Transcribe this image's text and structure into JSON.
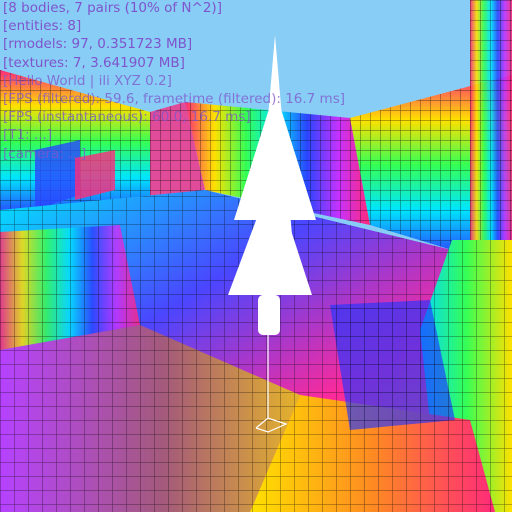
{
  "hud": {
    "lines": [
      "[8 bodies, 7 pairs (10% of N^2)]",
      "[entities: 8]",
      "[rmodels: 97, 0.351723 MB]",
      "[textures: 7, 3.641907 MB]",
      "[Hello World | ili XYZ 0.2]",
      "[FPS (filtered): 59.6, frametime (filtered): 16.7 ms]",
      "[FPS (instantaneous): 60.0, 16.7 ms]",
      "[T1: ...]",
      "[camera: ...]"
    ]
  },
  "colors": {
    "sky": "#87cdf5",
    "hud_text": "#7f54cc",
    "object": "#ffffff",
    "grid_line": "#000000"
  },
  "scene": {
    "object_icon": "white-cone-tree-icon"
  }
}
